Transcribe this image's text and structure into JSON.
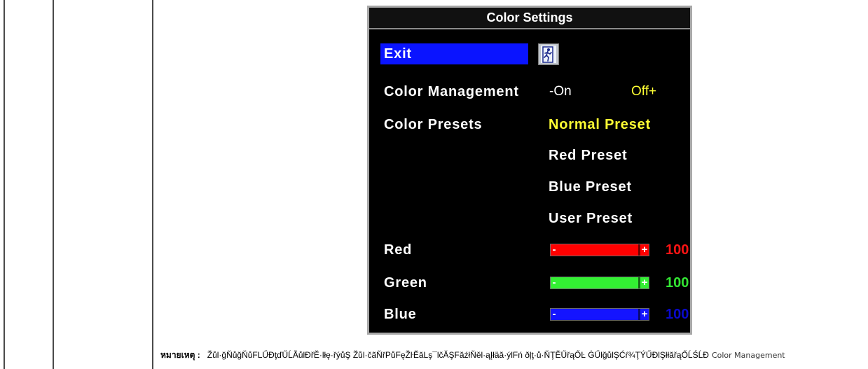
{
  "page": {
    "background": "#ffffff",
    "rule_color": "#4a4a4a"
  },
  "osd": {
    "title": "Color Settings",
    "colors": {
      "frame": "#a8a8a8",
      "title_bar": "#111111",
      "panel": "#000000",
      "highlight": "#0a14ff",
      "text": "#ffffff",
      "selected": "#ffff33"
    },
    "exit": {
      "label": "Exit",
      "icon": "exit-icon",
      "highlighted": true
    },
    "color_management": {
      "label": "Color Management",
      "options": [
        "-On",
        "Off+"
      ],
      "selected_index": 1
    },
    "color_presets": {
      "label": "Color Presets",
      "options": [
        "Normal Preset",
        "Red Preset",
        "Blue Preset",
        "User Preset"
      ],
      "selected_index": 0
    },
    "slider_minus": "-",
    "slider_plus": "+",
    "channels": [
      {
        "label": "Red",
        "value": 100,
        "color": "#ff0000",
        "value_color": "#ff1414"
      },
      {
        "label": "Green",
        "value": 100,
        "color": "#33f033",
        "value_color": "#33e633"
      },
      {
        "label": "Blue",
        "value": 100,
        "color": "#1414ff",
        "value_color": "#0a0acc"
      }
    ]
  },
  "note": {
    "label": "หมายเหตุ :",
    "text": "Žůl·ğŇůğŇůFLŰĐţďŰĹÃůlĐřĚ·lłę·řýůŞ Žůl·čãŇřPůFęŽŀĚăLş¯lčĂŞFăźłŇěl·ąĮłäă·ýlFń ðļţ·ů·ŇŢĚŰřąŐĿ ĠŰlğůlŞĆŕ¾ŢÝŰĐlŞłłăřąŐĹŚĹĐ",
    "term": "Color Management"
  }
}
